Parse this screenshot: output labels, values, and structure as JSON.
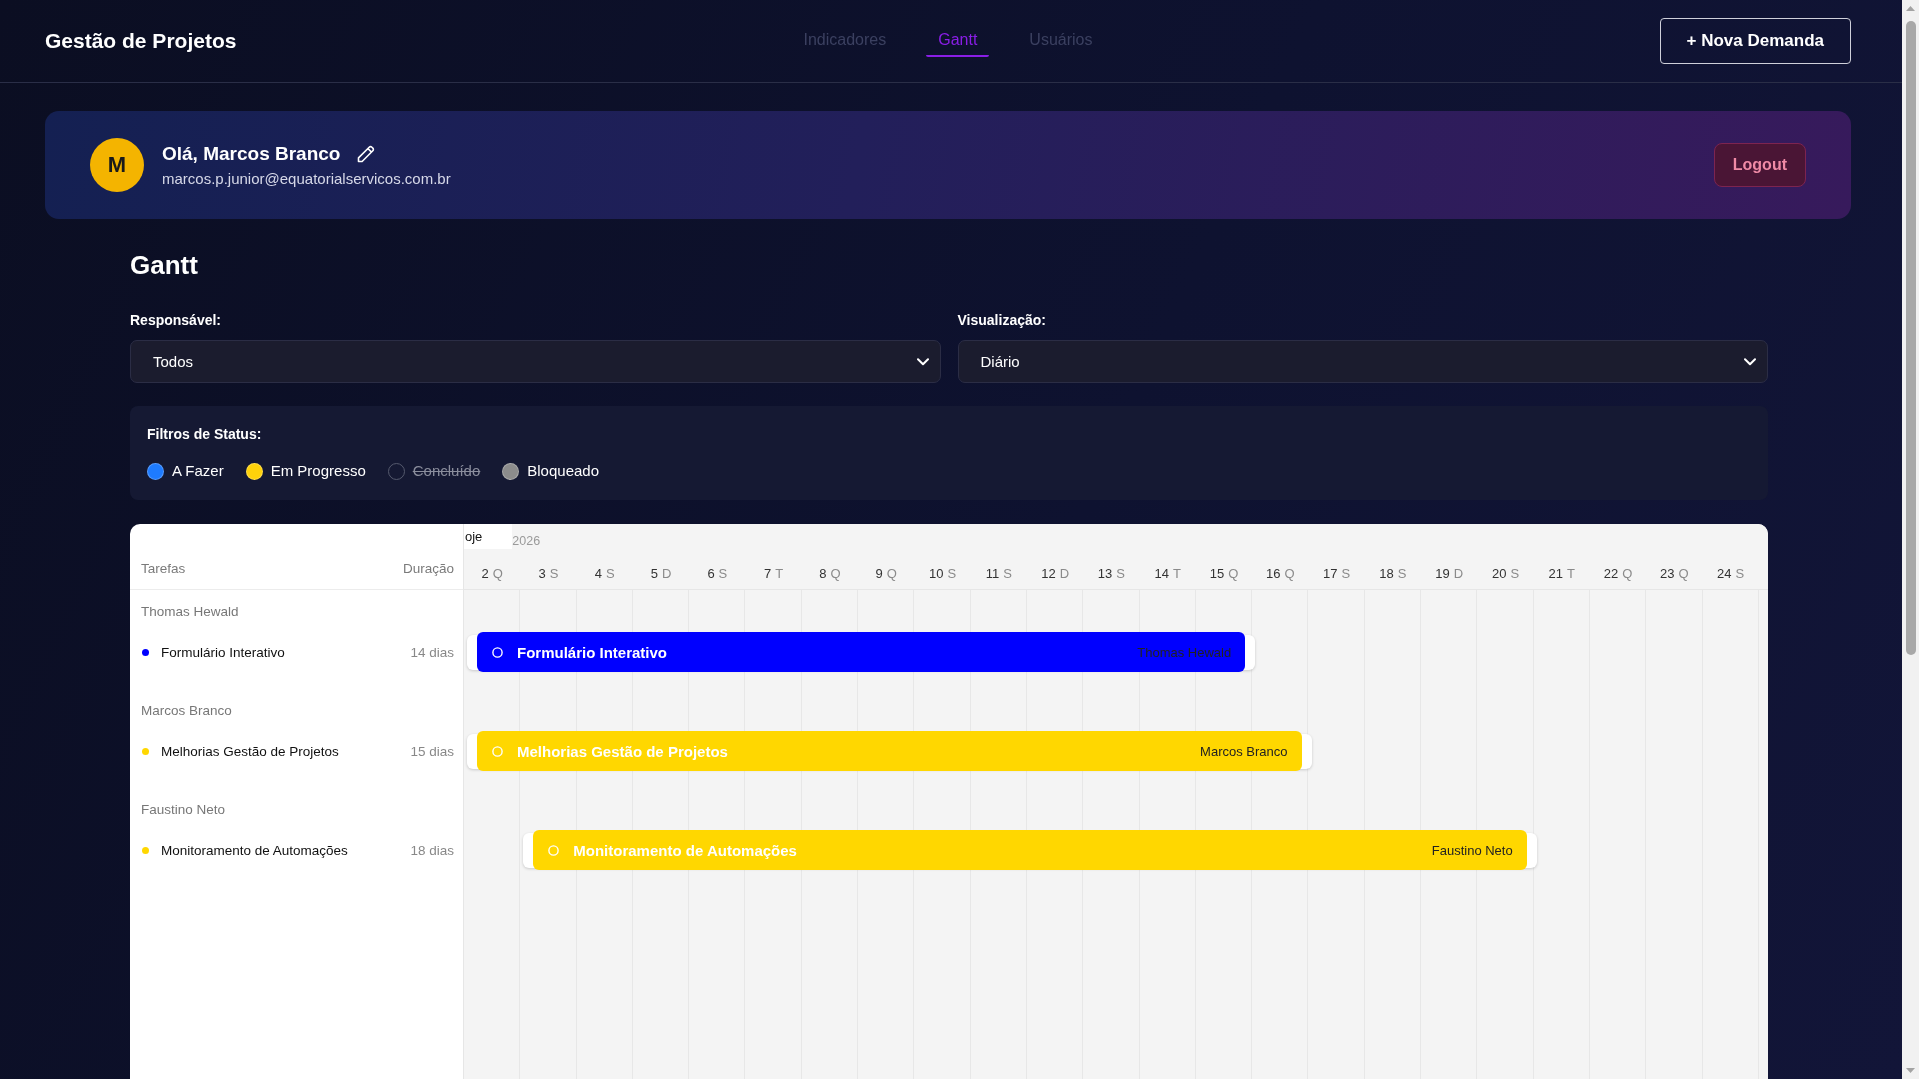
{
  "header": {
    "title": "Gestão de Projetos",
    "nav": [
      {
        "label": "Indicadores",
        "selected": false
      },
      {
        "label": "Gantt",
        "selected": true
      },
      {
        "label": "Usuários",
        "selected": false
      }
    ],
    "action_button": "+ Nova Demanda"
  },
  "profile": {
    "avatar_initial": "M",
    "greeting": "Olá, Marcos Branco",
    "email": "marcos.p.junior@equatorialservicos.com.br",
    "logout_button": "Logout"
  },
  "gantt": {
    "title": "Gantt",
    "filters": [
      {
        "label": "Responsável:",
        "value": "Todos"
      },
      {
        "label": "Visualização:",
        "value": "Diário"
      }
    ],
    "status_filters": {
      "title": "Filtros de Status:",
      "items": [
        {
          "label": "A Fazer",
          "checked": true,
          "color": "#1e7bff"
        },
        {
          "label": "Em Progresso",
          "checked": true,
          "color": "#ffd20a"
        },
        {
          "label": "Concluído",
          "checked": false
        },
        {
          "label": "Bloqueado",
          "checked": true,
          "color": "#8c8c8c"
        }
      ]
    },
    "chart": {
      "task_column": "Tarefas",
      "duration_column": "Duração",
      "today_marker": "oje",
      "year_label": "2026",
      "days": [
        {
          "day": "2",
          "weekday": "Q"
        },
        {
          "day": "3",
          "weekday": "S"
        },
        {
          "day": "4",
          "weekday": "S"
        },
        {
          "day": "5",
          "weekday": "D"
        },
        {
          "day": "6",
          "weekday": "S"
        },
        {
          "day": "7",
          "weekday": "T"
        },
        {
          "day": "8",
          "weekday": "Q"
        },
        {
          "day": "9",
          "weekday": "Q"
        },
        {
          "day": "10",
          "weekday": "S"
        },
        {
          "day": "11",
          "weekday": "S"
        },
        {
          "day": "12",
          "weekday": "D"
        },
        {
          "day": "13",
          "weekday": "S"
        },
        {
          "day": "14",
          "weekday": "T"
        },
        {
          "day": "15",
          "weekday": "Q"
        },
        {
          "day": "16",
          "weekday": "Q"
        },
        {
          "day": "17",
          "weekday": "S"
        },
        {
          "day": "18",
          "weekday": "S"
        },
        {
          "day": "19",
          "weekday": "D"
        },
        {
          "day": "20",
          "weekday": "S"
        },
        {
          "day": "21",
          "weekday": "T"
        },
        {
          "day": "22",
          "weekday": "Q"
        },
        {
          "day": "23",
          "weekday": "Q"
        },
        {
          "day": "24",
          "weekday": "S"
        }
      ],
      "groups": [
        {
          "assignee": "Thomas Hewald",
          "tasks": [
            {
              "name": "Formulário Interativo",
              "duration": "14 dias",
              "starts_today": true,
              "color": "#0000ff",
              "bar_title": "Formulário Interativo",
              "bar_owner": "Thomas Hewald"
            }
          ]
        },
        {
          "assignee": "Marcos Branco",
          "tasks": [
            {
              "name": "Melhorias Gestão de Projetos",
              "duration": "15 dias",
              "starts_today": true,
              "color": "#ffd700",
              "bar_title": "Melhorias Gestão de Projetos",
              "bar_owner": "Marcos Branco"
            }
          ]
        },
        {
          "assignee": "Faustino Neto",
          "tasks": [
            {
              "name": "Monitoramento de Automações",
              "duration": "18 dias",
              "starts_today": false,
              "color": "#ffd700",
              "bar_title": "Monitoramento de Automações",
              "bar_owner": "Faustino Neto"
            }
          ]
        }
      ]
    }
  }
}
